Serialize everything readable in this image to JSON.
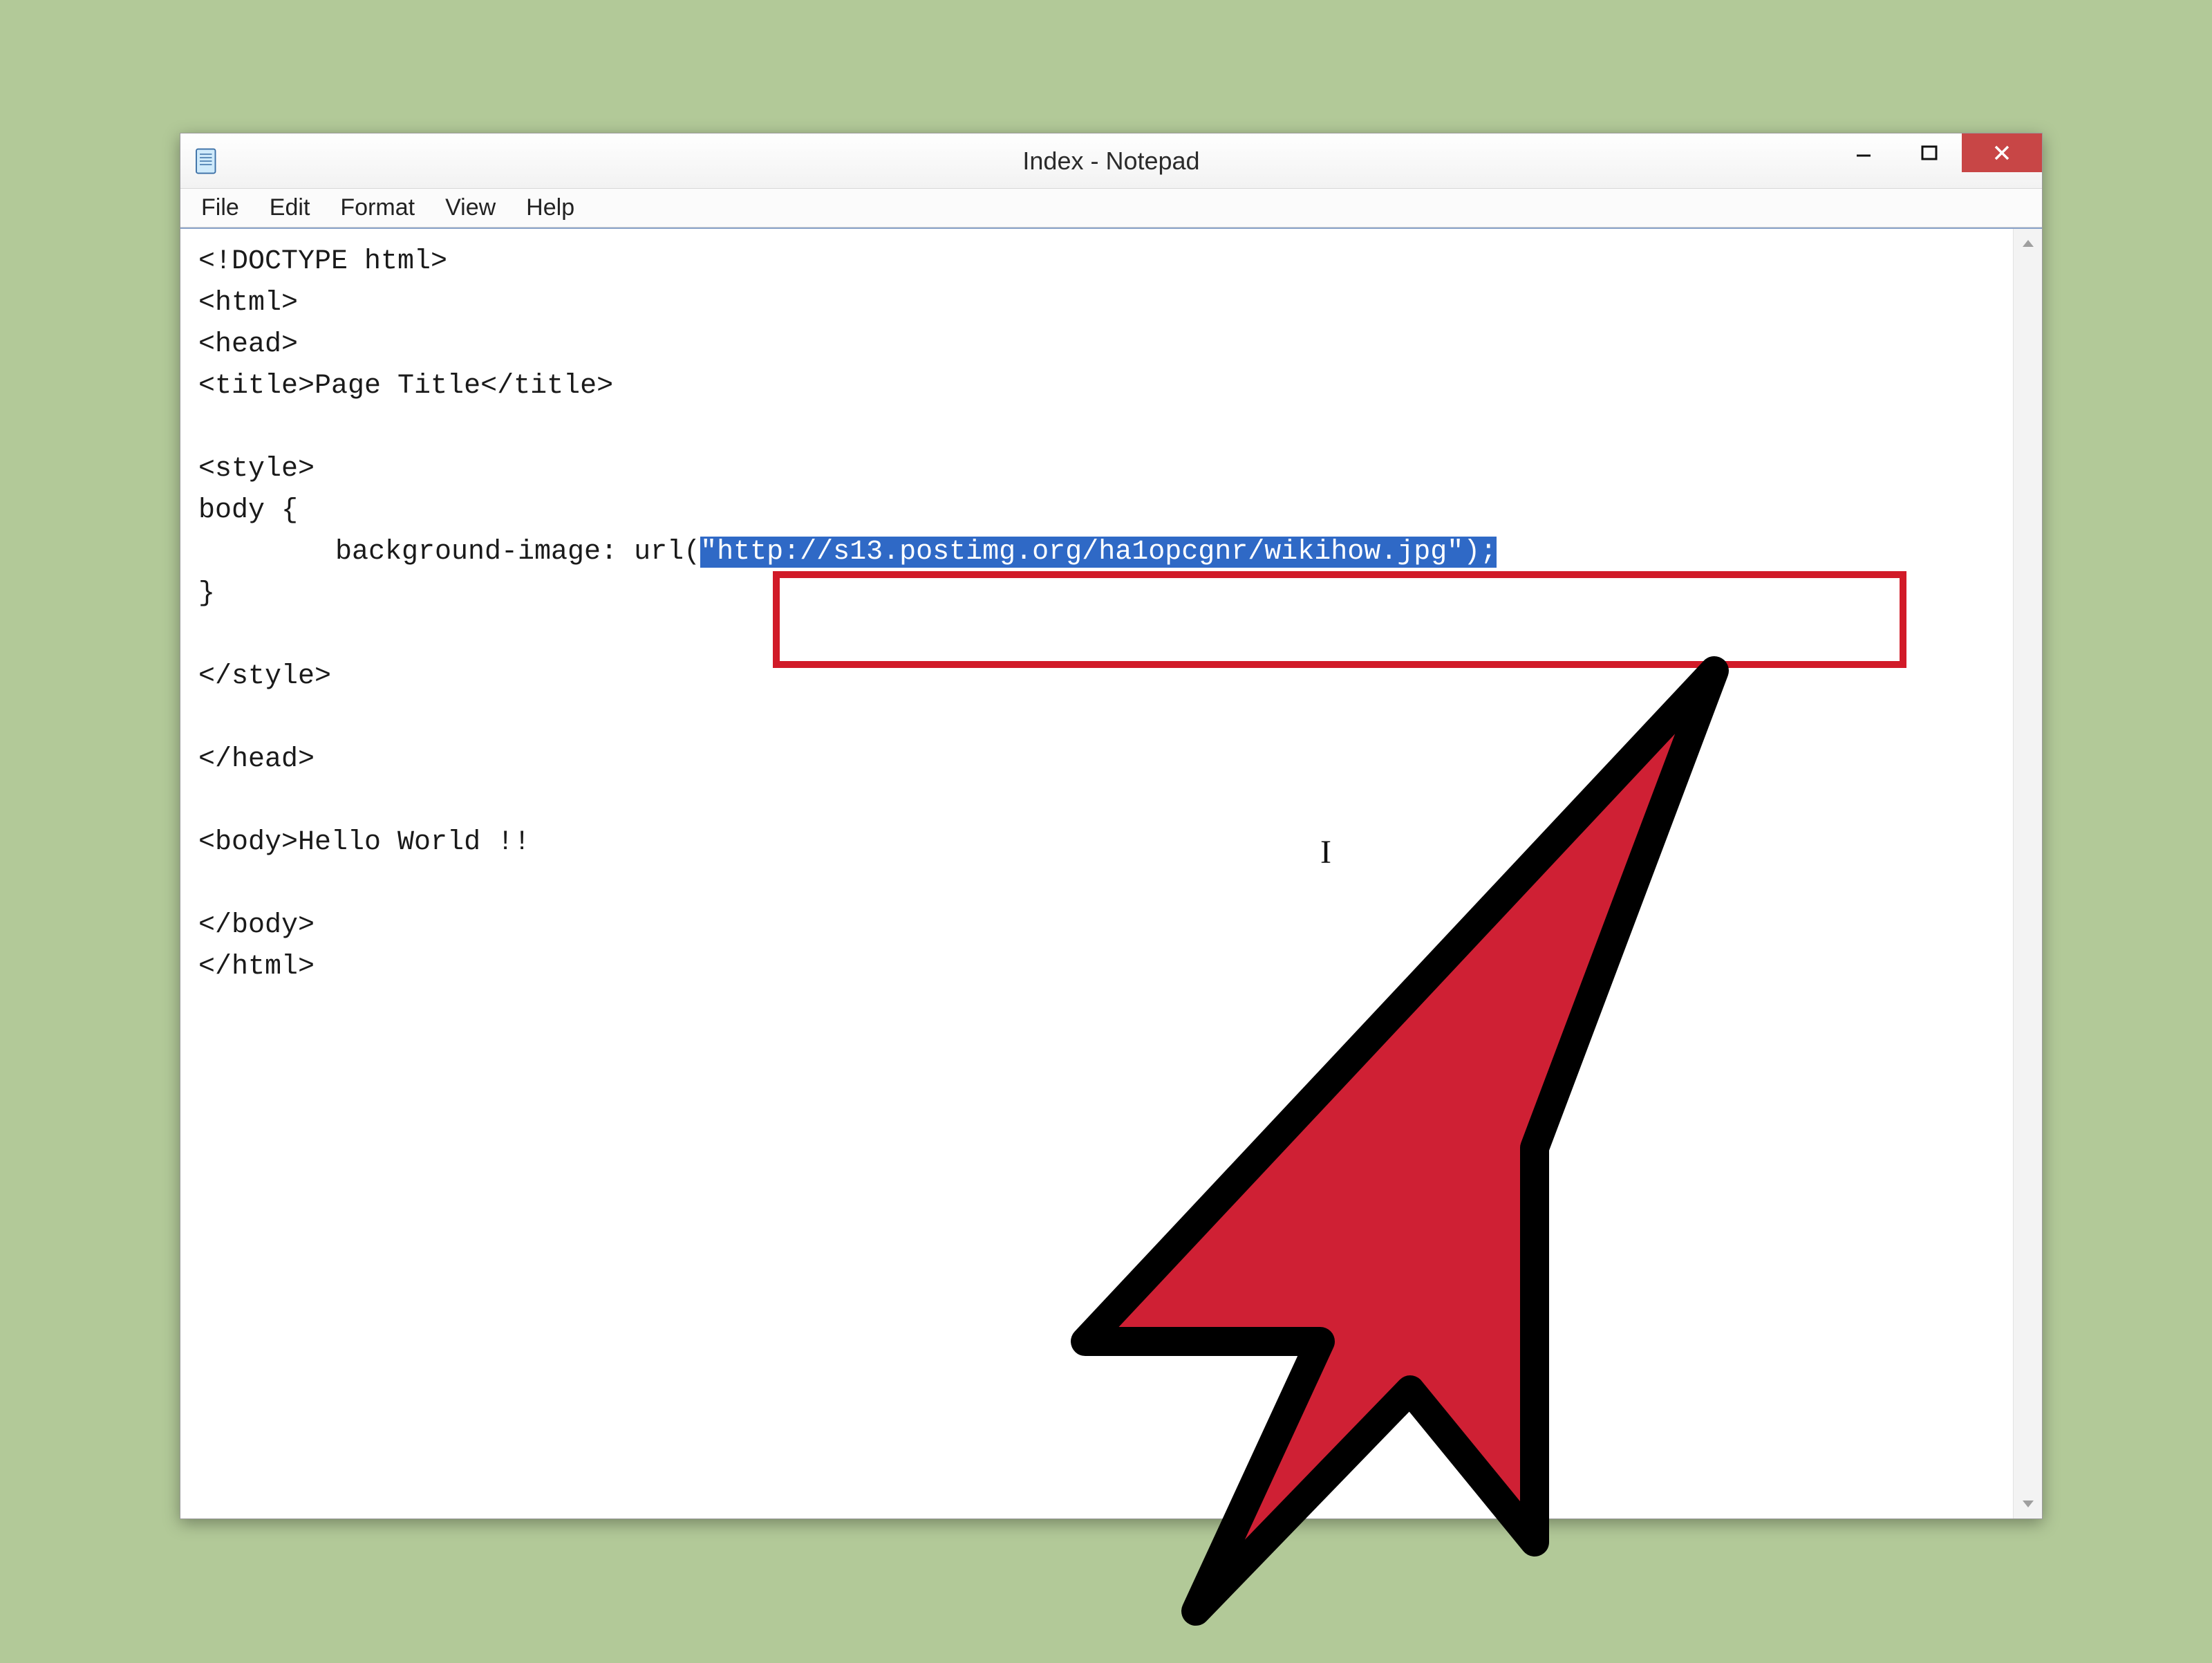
{
  "window": {
    "title": "Index - Notepad"
  },
  "menubar": {
    "items": [
      "File",
      "Edit",
      "Format",
      "View",
      "Help"
    ]
  },
  "editor": {
    "lines": {
      "l0": "<!DOCTYPE html>",
      "l1": "<html>",
      "l2": "<head>",
      "l3": "<title>Page Title</title>",
      "l4": "",
      "l5": "<style>",
      "l6": "body {",
      "l7_prefix": "background-image: url(",
      "l7_selected": "\"http://s13.postimg.org/ha1opcgnr/wikihow.jpg\");",
      "l8": "}",
      "l9": "",
      "l10": "</style>",
      "l11": "",
      "l12": "</head>",
      "l13": "",
      "l14": "<body>Hello World !!",
      "l15": "",
      "l16": "</body>",
      "l17": "</html>"
    }
  }
}
